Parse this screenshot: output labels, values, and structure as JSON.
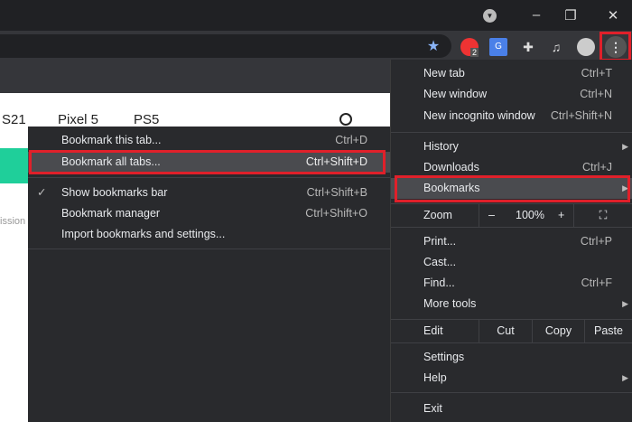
{
  "window": {
    "minimize": "–",
    "restore": "❐",
    "close": "✕"
  },
  "toolbar": {
    "star": "★",
    "ext_badge": "2",
    "menu": "⋮"
  },
  "page": {
    "nav": [
      "S21",
      "Pixel 5",
      "PS5"
    ],
    "fragment": "ission"
  },
  "main_menu": {
    "new_tab": {
      "label": "New tab",
      "shortcut": "Ctrl+T"
    },
    "new_window": {
      "label": "New window",
      "shortcut": "Ctrl+N"
    },
    "incognito": {
      "label": "New incognito window",
      "shortcut": "Ctrl+Shift+N"
    },
    "history": {
      "label": "History"
    },
    "downloads": {
      "label": "Downloads",
      "shortcut": "Ctrl+J"
    },
    "bookmarks": {
      "label": "Bookmarks"
    },
    "zoom": {
      "label": "Zoom",
      "minus": "–",
      "value": "100%",
      "plus": "+"
    },
    "print": {
      "label": "Print...",
      "shortcut": "Ctrl+P"
    },
    "cast": {
      "label": "Cast..."
    },
    "find": {
      "label": "Find...",
      "shortcut": "Ctrl+F"
    },
    "more_tools": {
      "label": "More tools"
    },
    "edit": {
      "label": "Edit",
      "cut": "Cut",
      "copy": "Copy",
      "paste": "Paste"
    },
    "settings": {
      "label": "Settings"
    },
    "help": {
      "label": "Help"
    },
    "exit": {
      "label": "Exit"
    }
  },
  "bookmarks_menu": {
    "this_tab": {
      "label": "Bookmark this tab...",
      "shortcut": "Ctrl+D"
    },
    "all_tabs": {
      "label": "Bookmark all tabs...",
      "shortcut": "Ctrl+Shift+D"
    },
    "show_bar": {
      "label": "Show bookmarks bar",
      "shortcut": "Ctrl+Shift+B",
      "check": "✓"
    },
    "manager": {
      "label": "Bookmark manager",
      "shortcut": "Ctrl+Shift+O"
    },
    "import": {
      "label": "Import bookmarks and settings..."
    }
  }
}
